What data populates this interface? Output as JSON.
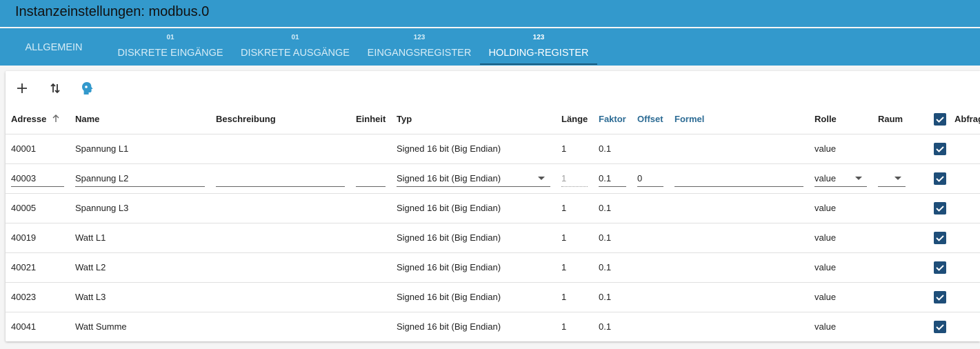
{
  "window": {
    "title": "Instanzeinstellungen: modbus.0"
  },
  "tabs": [
    {
      "label": "ALLGEMEIN",
      "badge": ""
    },
    {
      "label": "DISKRETE EINGÄNGE",
      "badge": "01"
    },
    {
      "label": "DISKRETE AUSGÄNGE",
      "badge": "01"
    },
    {
      "label": "EINGANGSREGISTER",
      "badge": "123"
    },
    {
      "label": "HOLDING-REGISTER",
      "badge": "123"
    }
  ],
  "active_tab": "HOLDING-REGISTER",
  "toolbar": {
    "icons": [
      "add-icon",
      "sort-icon",
      "head-profile-icon"
    ]
  },
  "columns": {
    "address": "Adresse",
    "name": "Name",
    "description": "Beschreibung",
    "unit": "Einheit",
    "type": "Typ",
    "length": "Länge",
    "factor": "Faktor",
    "offset": "Offset",
    "formula": "Formel",
    "role": "Rolle",
    "room": "Raum",
    "poll": "Abfrag"
  },
  "rows": [
    {
      "address": "40001",
      "name": "Spannung L1",
      "type": "Signed 16 bit (Big Endian)",
      "length": "1",
      "factor": "0.1",
      "role": "value",
      "poll": true
    },
    {
      "address": "40003",
      "name": "Spannung L2",
      "type": "Signed 16 bit (Big Endian)",
      "length": "1",
      "factor": "0.1",
      "offset": "0",
      "role": "value",
      "poll": true,
      "editing": true
    },
    {
      "address": "40005",
      "name": "Spannung L3",
      "type": "Signed 16 bit (Big Endian)",
      "length": "1",
      "factor": "0.1",
      "role": "value",
      "poll": true
    },
    {
      "address": "40019",
      "name": "Watt L1",
      "type": "Signed 16 bit (Big Endian)",
      "length": "1",
      "factor": "0.1",
      "role": "value",
      "poll": true
    },
    {
      "address": "40021",
      "name": "Watt L2",
      "type": "Signed 16 bit (Big Endian)",
      "length": "1",
      "factor": "0.1",
      "role": "value",
      "poll": true
    },
    {
      "address": "40023",
      "name": "Watt L3",
      "type": "Signed 16 bit (Big Endian)",
      "length": "1",
      "factor": "0.1",
      "role": "value",
      "poll": true
    },
    {
      "address": "40041",
      "name": "Watt Summe",
      "type": "Signed 16 bit (Big Endian)",
      "length": "1",
      "factor": "0.1",
      "role": "value",
      "poll": true
    }
  ],
  "colors": {
    "accent": "#3399cc",
    "checkbox": "#1e4e79",
    "link_header": "#2c6b94"
  }
}
